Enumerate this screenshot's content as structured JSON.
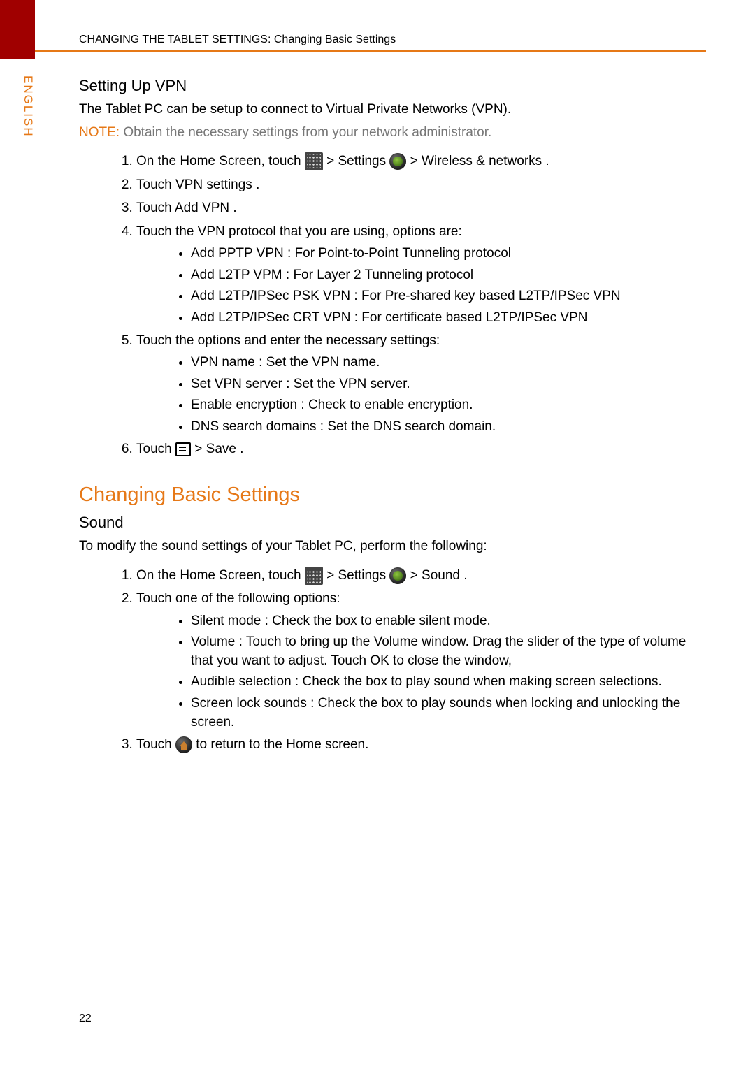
{
  "header": "CHANGING THE TABLET SETTINGS: Changing Basic Settings",
  "side_label": "ENGLISH",
  "page_number": "22",
  "vpn": {
    "heading": "Setting Up VPN",
    "intro": "The Tablet PC can be setup to connect to Virtual Private Networks (VPN).",
    "note_label": "NOTE:",
    "note_body": " Obtain the necessary settings from your network administrator.",
    "step1_pre": "On the Home Screen, touch ",
    "step1_settings": " > Settings ",
    "step1_wireless": " > Wireless & networks  .",
    "step2": "Touch VPN settings .",
    "step3": "Touch Add VPN .",
    "step4": "Touch the VPN protocol that you are using, options are:",
    "step4_opts": [
      "Add PPTP VPN : For Point-to-Point Tunneling protocol",
      "Add L2TP VPM : For Layer 2 Tunneling protocol",
      "Add L2TP/IPSec PSK VPN : For Pre-shared key based L2TP/IPSec VPN",
      "Add L2TP/IPSec CRT VPN : For certificate based L2TP/IPSec VPN"
    ],
    "step5": "Touch the options and enter the necessary settings:",
    "step5_opts": [
      "VPN name : Set the VPN name.",
      "Set VPN server : Set the VPN server.",
      "Enable encryption   : Check to enable encryption.",
      "DNS search domains  : Set the DNS search domain."
    ],
    "step6_pre": "Touch ",
    "step6_post": " > Save ."
  },
  "basic": {
    "section_title": "Changing Basic Settings",
    "sound_heading": "Sound",
    "sound_intro": "To modify the sound settings of your Tablet PC, perform the following:",
    "step1_pre": "On the Home Screen, touch ",
    "step1_settings": " > Settings ",
    "step1_sound": " > Sound .",
    "step2": "Touch one of the following options:",
    "step2_opts": [
      "Silent mode : Check the box to enable silent mode.",
      "Volume : Touch to bring up the Volume window. Drag the slider of the type of volume that you want to adjust. Touch OK to close the window,",
      "Audible selection   : Check the box to play sound when making screen selections.",
      "Screen lock sounds   : Check the box to play sounds when locking and unlocking the screen."
    ],
    "step3_pre": "Touch ",
    "step3_post": " to return to the Home screen."
  }
}
